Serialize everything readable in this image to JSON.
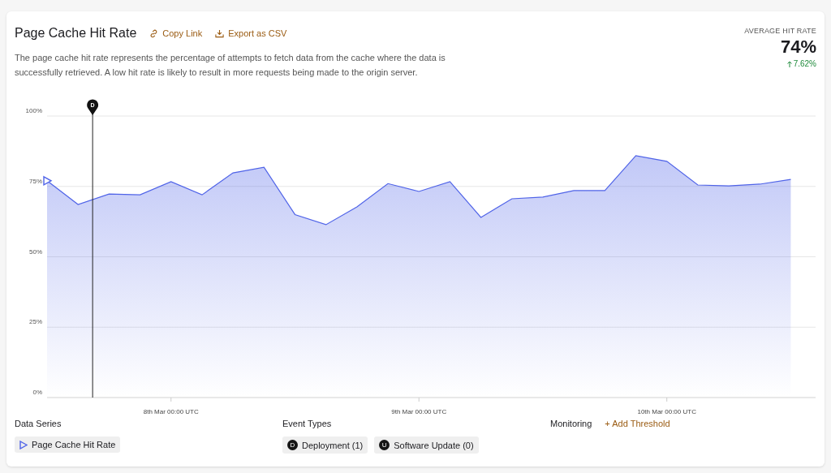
{
  "header": {
    "title": "Page Cache Hit Rate",
    "actions": [
      {
        "kind": "link",
        "label": "Copy Link"
      },
      {
        "kind": "export",
        "label": "Export as CSV"
      }
    ],
    "description": "The page cache hit rate represents the percentage of attempts to fetch data from the cache where the data is successfully retrieved. A low hit rate is likely to result in more requests being made to the origin server."
  },
  "summary": {
    "label": "AVERAGE HIT RATE",
    "value": "74%",
    "change": "7.62%"
  },
  "chart": {
    "chart_data": {
      "type": "area",
      "categories": [
        null,
        null,
        null,
        null,
        "8th Mar 00:00 UTC",
        null,
        null,
        null,
        null,
        null,
        null,
        null,
        "9th Mar 00:00 UTC",
        null,
        null,
        null,
        null,
        null,
        null,
        null,
        "10th Mar 00:00 UTC",
        null,
        null,
        null,
        null
      ],
      "series": [
        {
          "name": "Page Cache Hit Rate",
          "color": "#4f63e8",
          "values": [
            77,
            68.6,
            72.3,
            72,
            76.7,
            72,
            79.8,
            81.8,
            65,
            61.4,
            67.7,
            76,
            73.2,
            76.7,
            64,
            70.6,
            71.2,
            73.5,
            73.5,
            85.9,
            83.9,
            75.5,
            75.2,
            75.8,
            77.5
          ]
        }
      ],
      "ylim": [
        0,
        100
      ],
      "yticks": [
        {
          "value": 0,
          "label": "0%"
        },
        {
          "value": 25,
          "label": "25%"
        },
        {
          "value": 50,
          "label": "50%"
        },
        {
          "value": 75,
          "label": "75%"
        },
        {
          "value": 100,
          "label": "100%"
        }
      ],
      "grid": true,
      "annotations": [
        "D"
      ]
    }
  },
  "legend": {
    "data_series": {
      "title": "Data Series"
    },
    "event_types": {
      "title": "Event Types",
      "items": [
        {
          "badge": "D",
          "label": "Deployment (1)"
        },
        {
          "badge": "U",
          "label": "Software Update (0)"
        }
      ]
    },
    "monitoring": {
      "title": "Monitoring",
      "action": "+ Add Threshold"
    }
  }
}
